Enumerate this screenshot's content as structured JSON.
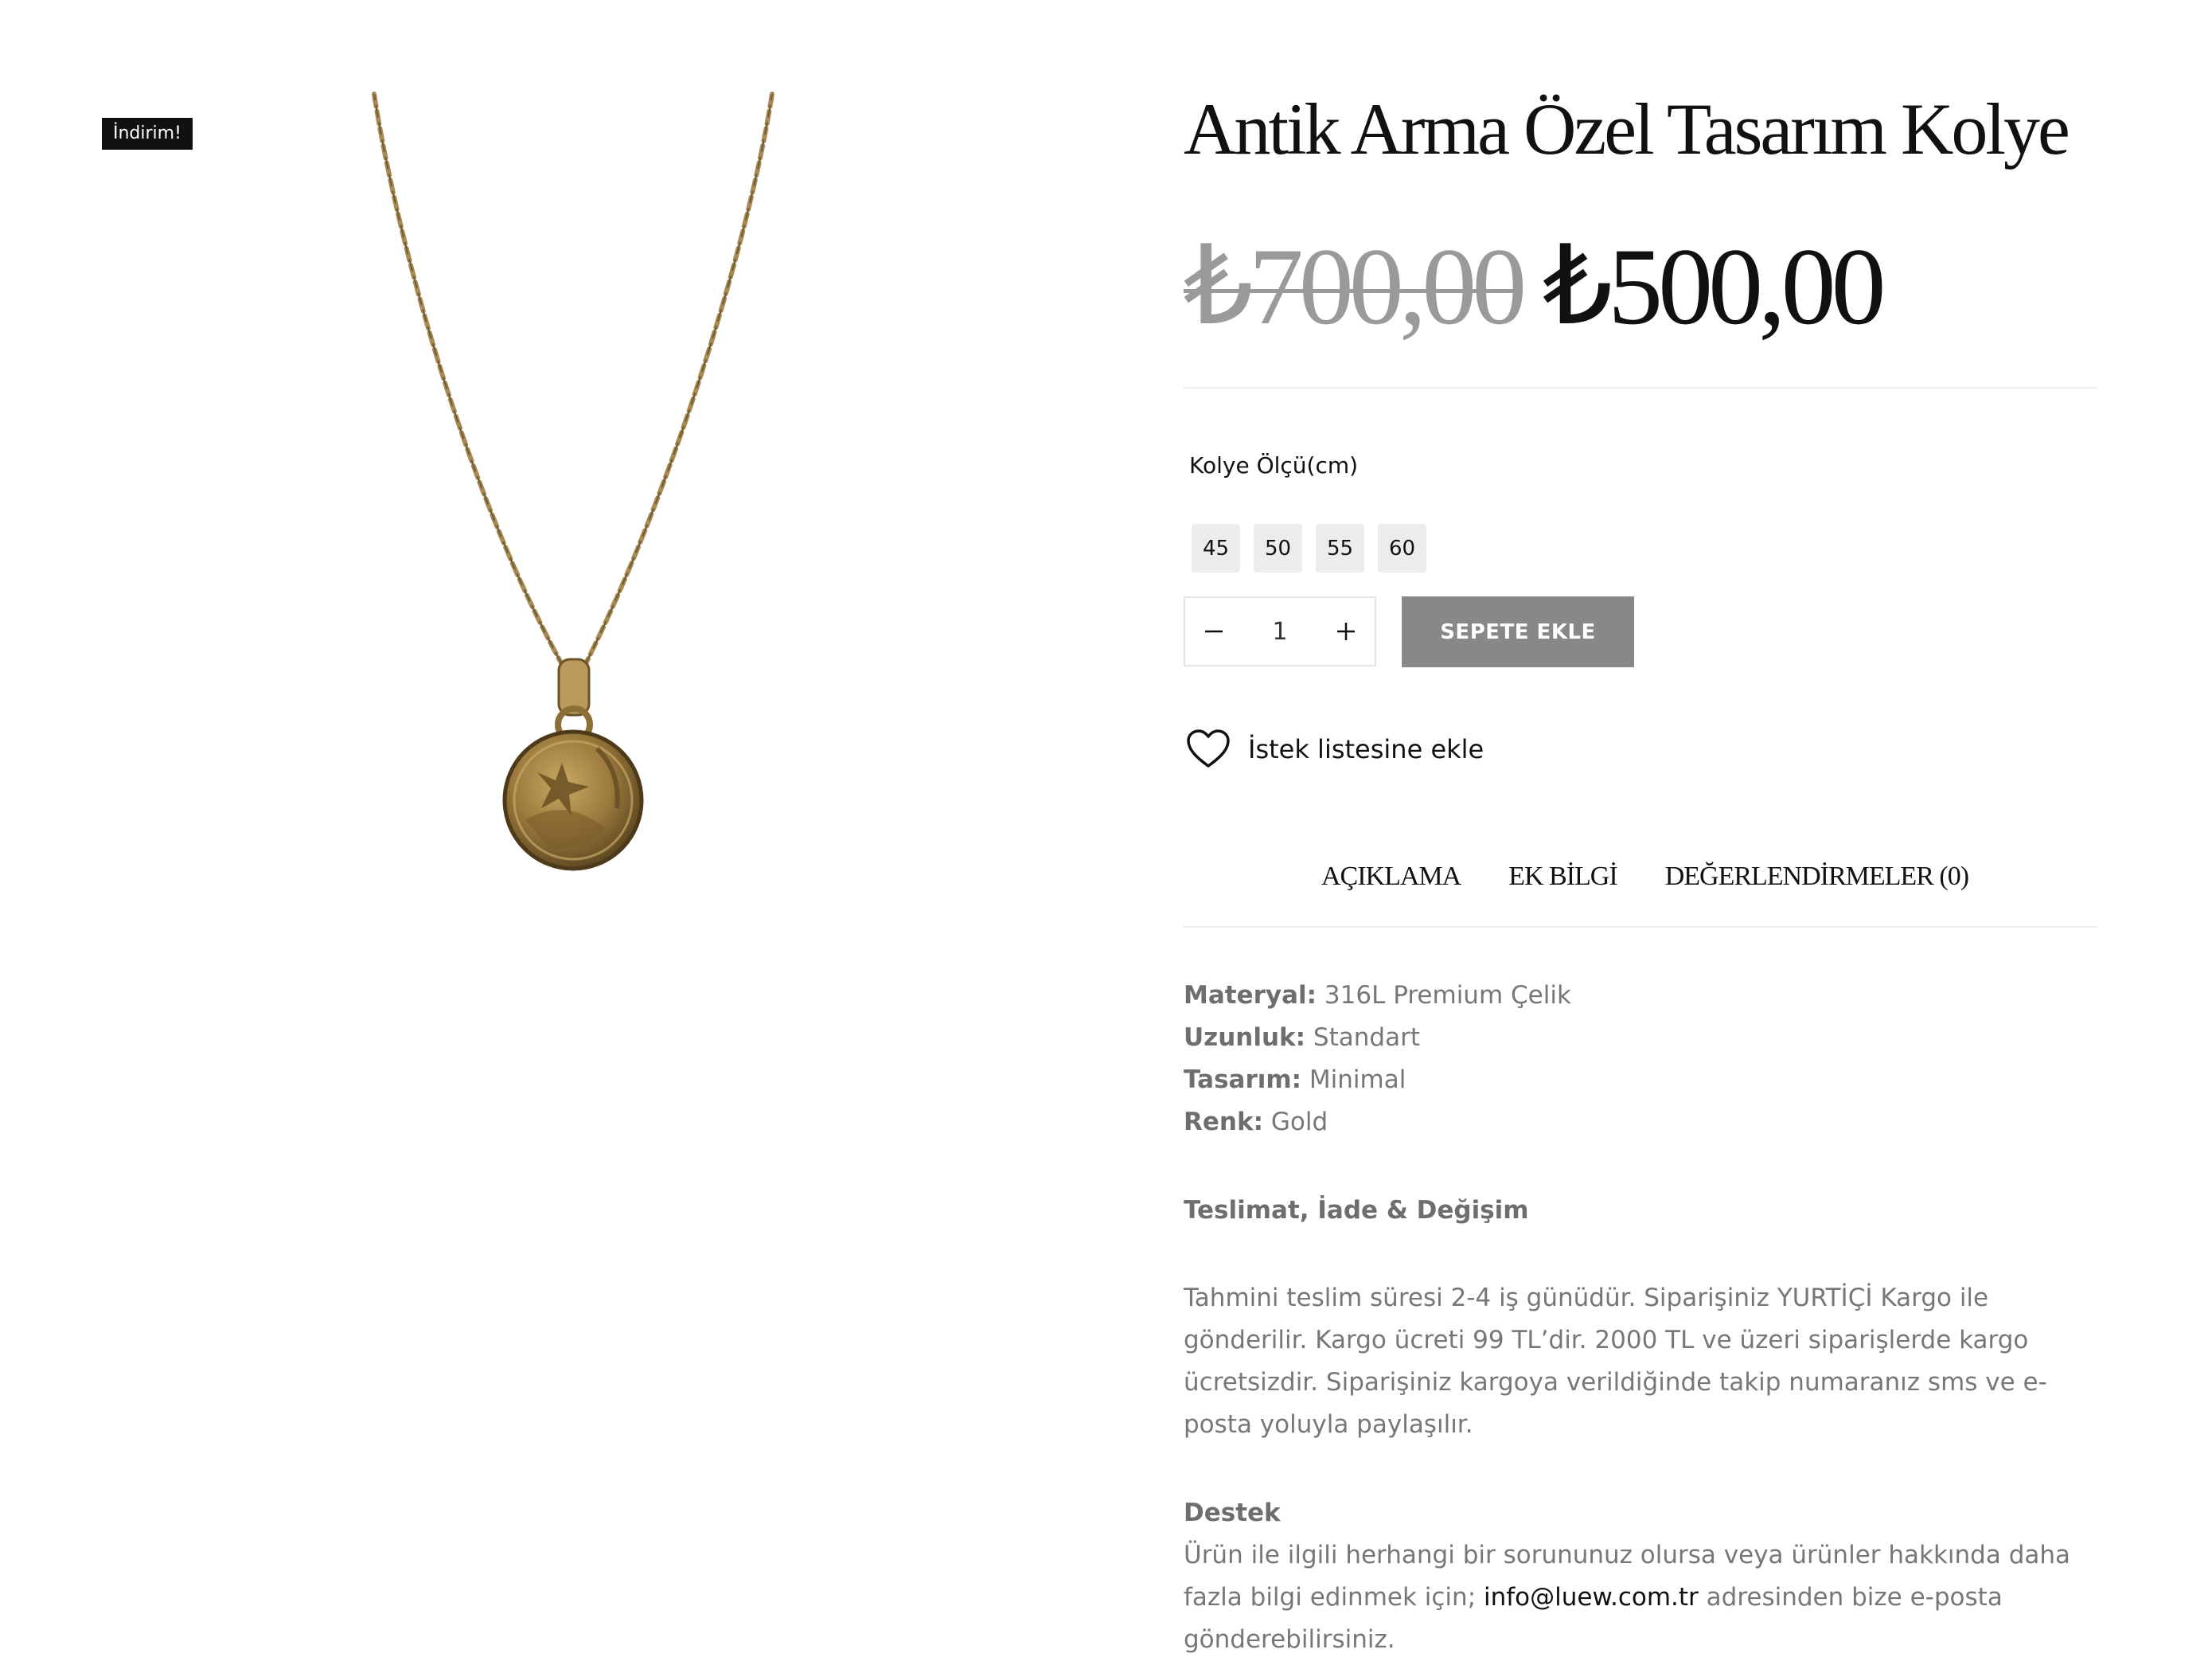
{
  "badge": {
    "sale": "İndirim!"
  },
  "product": {
    "title": "Antik Arma Özel Tasarım Kolye",
    "price_old": "₺700,00",
    "price_new": "₺500,00",
    "image_icon": "gold-coin-necklace"
  },
  "variation": {
    "label": "Kolye Ölçü(cm)",
    "options": [
      "45",
      "50",
      "55",
      "60"
    ]
  },
  "cart": {
    "quantity": "1",
    "minus_icon": "minus-icon",
    "plus_icon": "plus-icon",
    "add_label": "SEPETE EKLE",
    "button_color": "#888888"
  },
  "wishlist": {
    "label": "İstek listesine ekle",
    "icon": "heart-icon"
  },
  "tabs": [
    {
      "label": "AÇIKLAMA"
    },
    {
      "label": "EK BİLGİ"
    },
    {
      "label": "DEĞERLENDİRMELER (0)"
    }
  ],
  "description": {
    "specs": [
      {
        "key": "Materyal:",
        "value": "316L Premium Çelik"
      },
      {
        "key": "Uzunluk:",
        "value": "Standart"
      },
      {
        "key": "Tasarım:",
        "value": "Minimal"
      },
      {
        "key": "Renk:",
        "value": "Gold"
      }
    ],
    "delivery_heading": "Teslimat, İade & Değişim",
    "delivery_text": "Tahmini teslim süresi 2-4 iş günüdür. Siparişiniz YURTİÇİ Kargo ile gönderilir. Kargo ücreti 99 TL’dir. 2000 TL ve üzeri siparişlerde kargo ücretsizdir. Siparişiniz kargoya verildiğinde takip numaranız sms ve e-posta yoluyla paylaşılır.",
    "support_heading": "Destek",
    "support_text_before": "Ürün ile ilgili herhangi bir sorununuz olursa veya ürünler hakkında daha fazla bilgi edinmek için; ",
    "support_email": "info@luew.com.tr",
    "support_text_after": " adresinden bize e-posta gönderebilirsiniz."
  }
}
